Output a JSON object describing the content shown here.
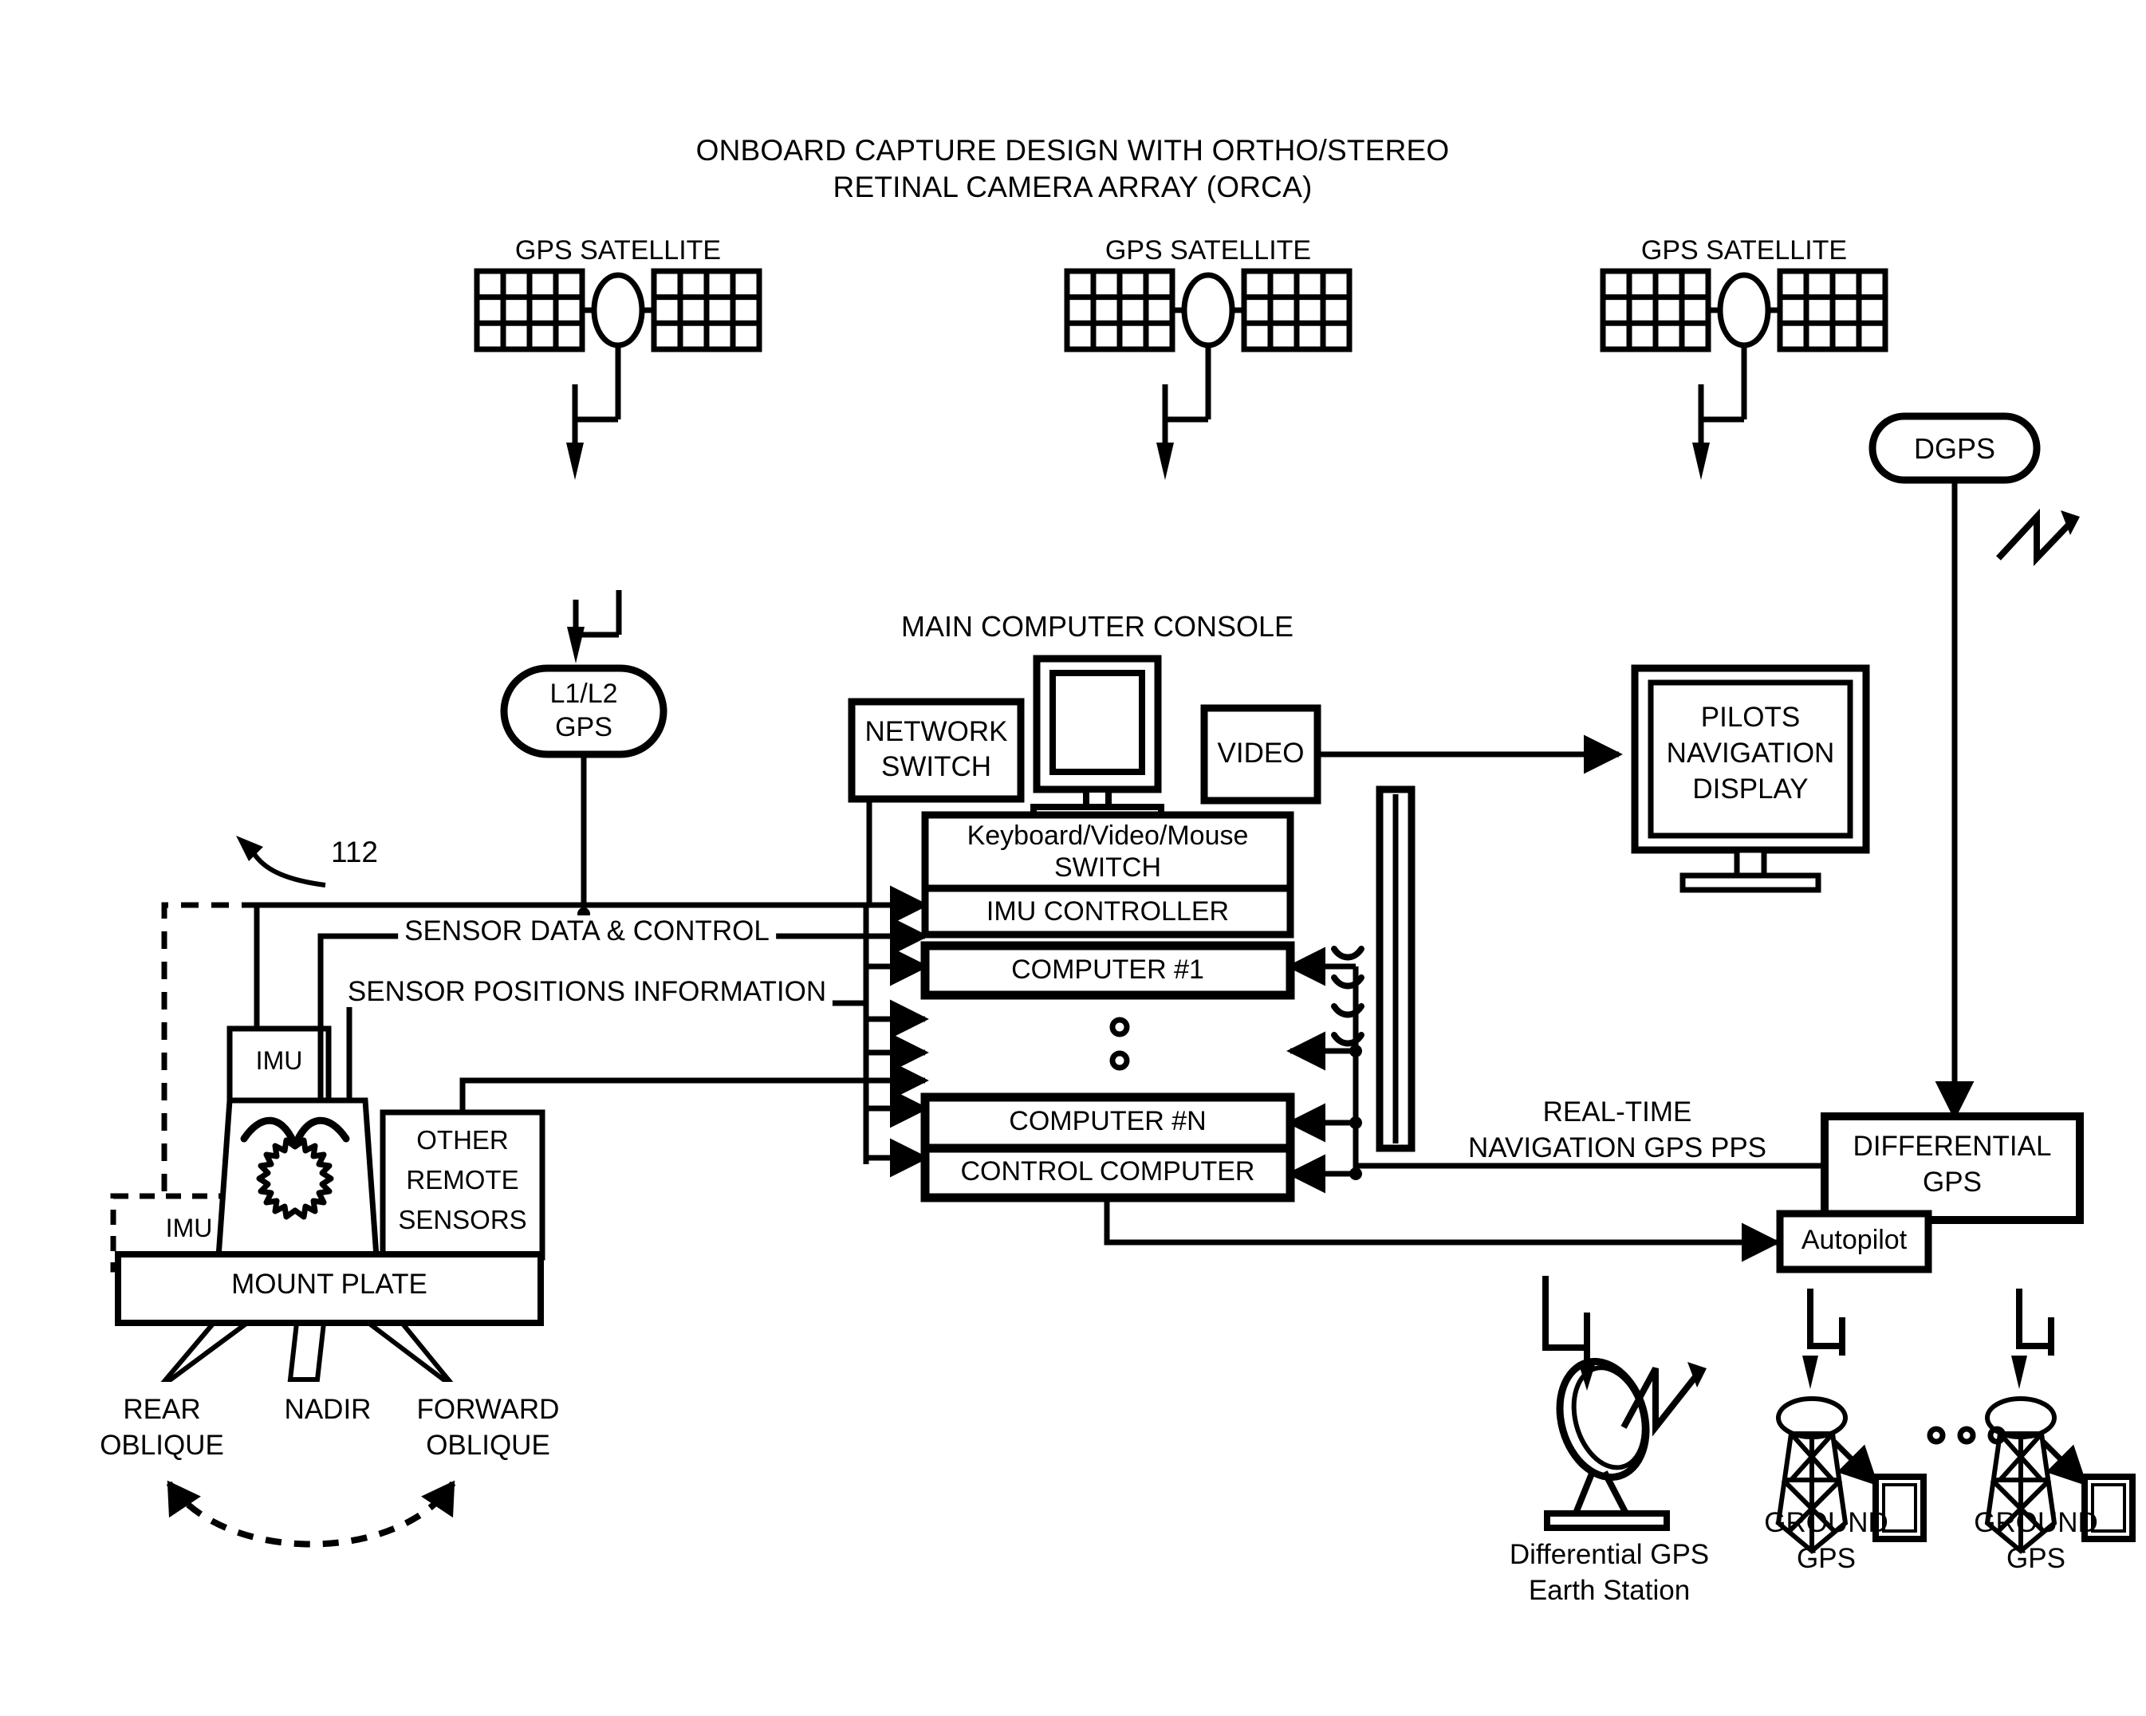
{
  "title": {
    "line1": "ONBOARD CAPTURE DESIGN WITH ORTHO/STEREO",
    "line2": "RETINAL CAMERA ARRAY (ORCA)"
  },
  "satellites": [
    {
      "label": "GPS SATELLITE"
    },
    {
      "label": "GPS SATELLITE"
    },
    {
      "label": "GPS SATELLITE"
    }
  ],
  "dgps": {
    "label": "DGPS"
  },
  "gps_receiver": {
    "line1": "L1/L2",
    "line2": "GPS"
  },
  "reference_numeral": "112",
  "console": {
    "heading": "MAIN COMPUTER CONSOLE",
    "network_switch": {
      "line1": "NETWORK",
      "line2": "SWITCH"
    },
    "video": {
      "label": "VIDEO"
    },
    "kvm": {
      "line1": "Keyboard/Video/Mouse",
      "line2": "SWITCH"
    },
    "imu_controller": {
      "label": "IMU CONTROLLER"
    },
    "computer_1": {
      "label": "COMPUTER #1"
    },
    "ellipsis": "vertical-dots",
    "computer_n": {
      "label": "COMPUTER #N"
    },
    "control_computer": {
      "label": "CONTROL COMPUTER"
    }
  },
  "pilots_display": {
    "line1": "PILOTS",
    "line2": "NAVIGATION",
    "line3": "DISPLAY"
  },
  "sensor_bus": {
    "data_control": "SENSOR DATA & CONTROL",
    "positions": "SENSOR POSITIONS INFORMATION"
  },
  "navigation_link": {
    "line1": "REAL-TIME",
    "line2": "NAVIGATION GPS PPS"
  },
  "differential_gps_box": {
    "line1": "DIFFERENTIAL",
    "line2": "GPS"
  },
  "autopilot": {
    "label": "Autopilot"
  },
  "mount_assembly": {
    "imu_primary": "IMU",
    "imu_alternate": "IMU",
    "other_remote_sensors": {
      "line1": "OTHER",
      "line2": "REMOTE",
      "line3": "SENSORS"
    },
    "mount_plate": "MOUNT PLATE",
    "camera_views": [
      {
        "line1": "REAR",
        "line2": "OBLIQUE"
      },
      {
        "line1": "NADIR",
        "line2": ""
      },
      {
        "line1": "FORWARD",
        "line2": "OBLIQUE"
      }
    ]
  },
  "ground": {
    "earth_station": {
      "line1": "Differential GPS",
      "line2": "Earth Station"
    },
    "stations": [
      {
        "line1": "GROUND",
        "line2": "GPS"
      },
      {
        "line1": "GROUND",
        "line2": "GPS"
      }
    ],
    "ellipsis": "horizontal-dots"
  },
  "colors": {
    "ink": "#000000",
    "paper": "#ffffff"
  }
}
